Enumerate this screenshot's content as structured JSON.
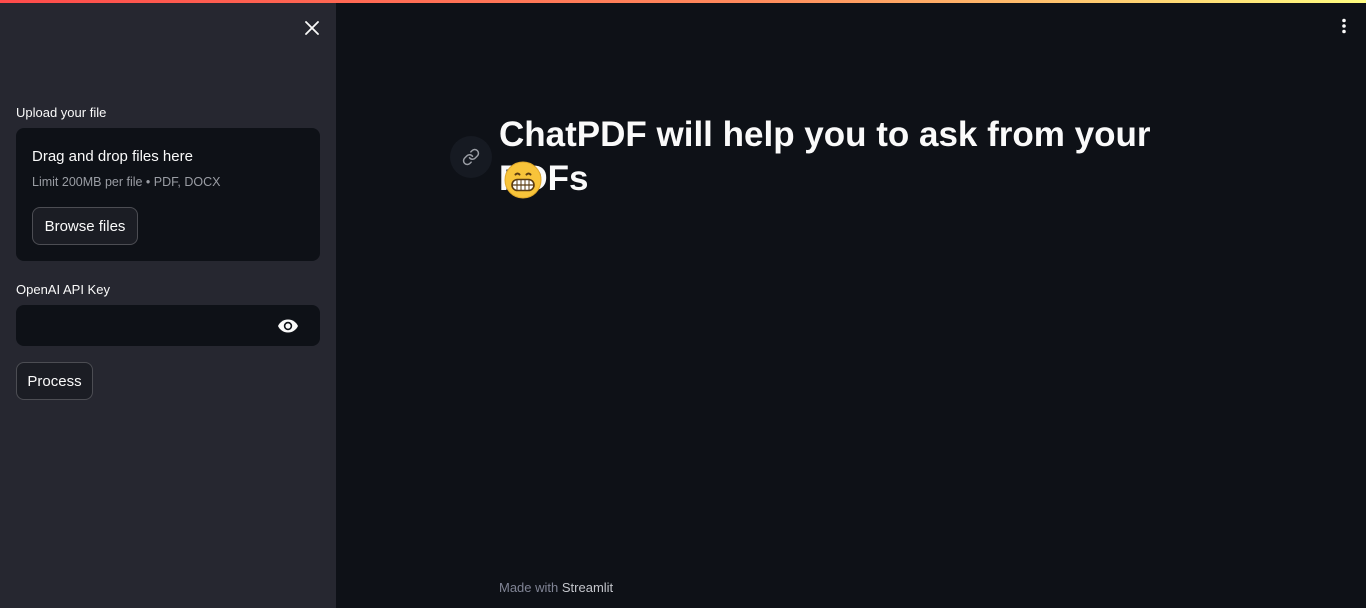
{
  "sidebar": {
    "upload_label": "Upload your file",
    "dropzone": {
      "title": "Drag and drop files here",
      "limit": "Limit 200MB per file • PDF, DOCX",
      "browse_label": "Browse files"
    },
    "api_key_label": "OpenAI API Key",
    "api_key_value": "",
    "process_label": "Process"
  },
  "main": {
    "title": "ChatPDF will help you to ask from your PDFs",
    "title_emoji_icon": "grinning-face-emoji"
  },
  "footer": {
    "prefix": "Made with",
    "brand": "Streamlit"
  },
  "colors": {
    "background": "#0e1117",
    "sidebar": "#262730",
    "accent": "#ff4b4b"
  },
  "icons": {
    "close": "close-icon",
    "visibility": "eye-icon",
    "menu": "more-vertical-icon",
    "anchor": "link-icon"
  }
}
